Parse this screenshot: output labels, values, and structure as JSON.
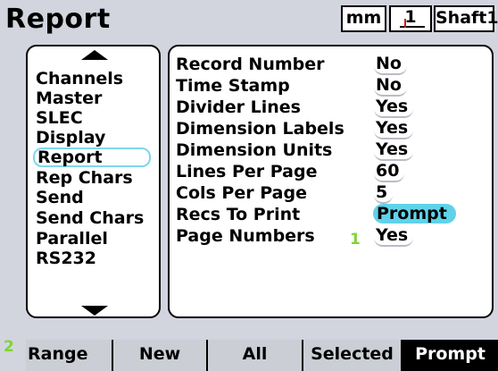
{
  "header": {
    "title": "Report",
    "units": "mm",
    "part_number": "1",
    "part_name": "Shaft1"
  },
  "menu": {
    "items": [
      {
        "label": "Channels"
      },
      {
        "label": "Master"
      },
      {
        "label": "SLEC"
      },
      {
        "label": "Display"
      },
      {
        "label": "Report",
        "selected": true
      },
      {
        "label": "Rep  Chars"
      },
      {
        "label": "Send"
      },
      {
        "label": "Send  Chars"
      },
      {
        "label": "Parallel"
      },
      {
        "label": "RS232"
      }
    ]
  },
  "settings": {
    "rows": [
      {
        "label": "Record  Number",
        "value": "No"
      },
      {
        "label": "Time  Stamp",
        "value": "No"
      },
      {
        "label": "Divider  Lines",
        "value": "Yes"
      },
      {
        "label": "Dimension  Labels",
        "value": "Yes"
      },
      {
        "label": "Dimension  Units",
        "value": "Yes"
      },
      {
        "label": "Lines  Per  Page",
        "value": "60"
      },
      {
        "label": "Cols  Per  Page",
        "value": "5"
      },
      {
        "label": "Recs  To  Print",
        "value": "Prompt",
        "highlighted": true
      },
      {
        "label": "Page  Numbers",
        "value": "Yes"
      }
    ]
  },
  "callouts": {
    "one": "1",
    "two": "2"
  },
  "softkeys": [
    {
      "label": "Range"
    },
    {
      "label": "New"
    },
    {
      "label": "All"
    },
    {
      "label": "Selected"
    },
    {
      "label": "Prompt",
      "active": true
    }
  ],
  "colors": {
    "screen_bg": "#d2d5de",
    "highlight": "#5fd2ea",
    "selection_outline": "#7fd7ea",
    "callout": "#7fd433",
    "part_tick": "#cc1a1a"
  }
}
